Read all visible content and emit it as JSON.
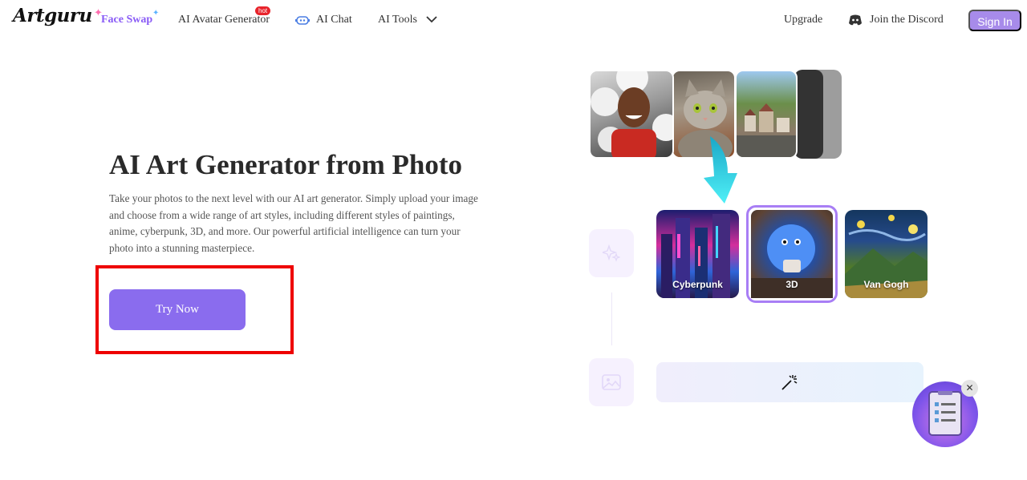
{
  "nav": {
    "logo": "Artguru",
    "face_swap": "Face Swap",
    "avatar_generator": "AI Avatar Generator",
    "hot_badge": "hot",
    "ai_chat": "AI Chat",
    "ai_tools": "AI Tools",
    "upgrade": "Upgrade",
    "discord": "Join the Discord",
    "sign_in": "Sign In"
  },
  "hero": {
    "title": "AI Art Generator from Photo",
    "description": "Take your photos to the next level with our AI art generator. Simply upload your image and choose from a wide range of art styles, including different styles of paintings, anime, cyberpunk, 3D, and more. Our powerful artificial intelligence can turn your photo into a stunning masterpiece.",
    "cta": "Try Now"
  },
  "styles": {
    "cyberpunk": "Cyberpunk",
    "threed": "3D",
    "van_gogh": "Van Gogh"
  },
  "colors": {
    "brand_purple": "#8a6cee",
    "sign_in_bg": "#a78bea",
    "highlight_red": "#ee0000",
    "hot_red": "#e8242c",
    "selected_border": "#a87ef5"
  },
  "icons": [
    "sparkle-icon",
    "chat-bot-icon",
    "chevron-down-icon",
    "discord-icon",
    "down-arrow-icon",
    "magic-sparkles-icon",
    "image-icon",
    "magic-wand-icon",
    "clipboard-icon",
    "close-icon"
  ]
}
